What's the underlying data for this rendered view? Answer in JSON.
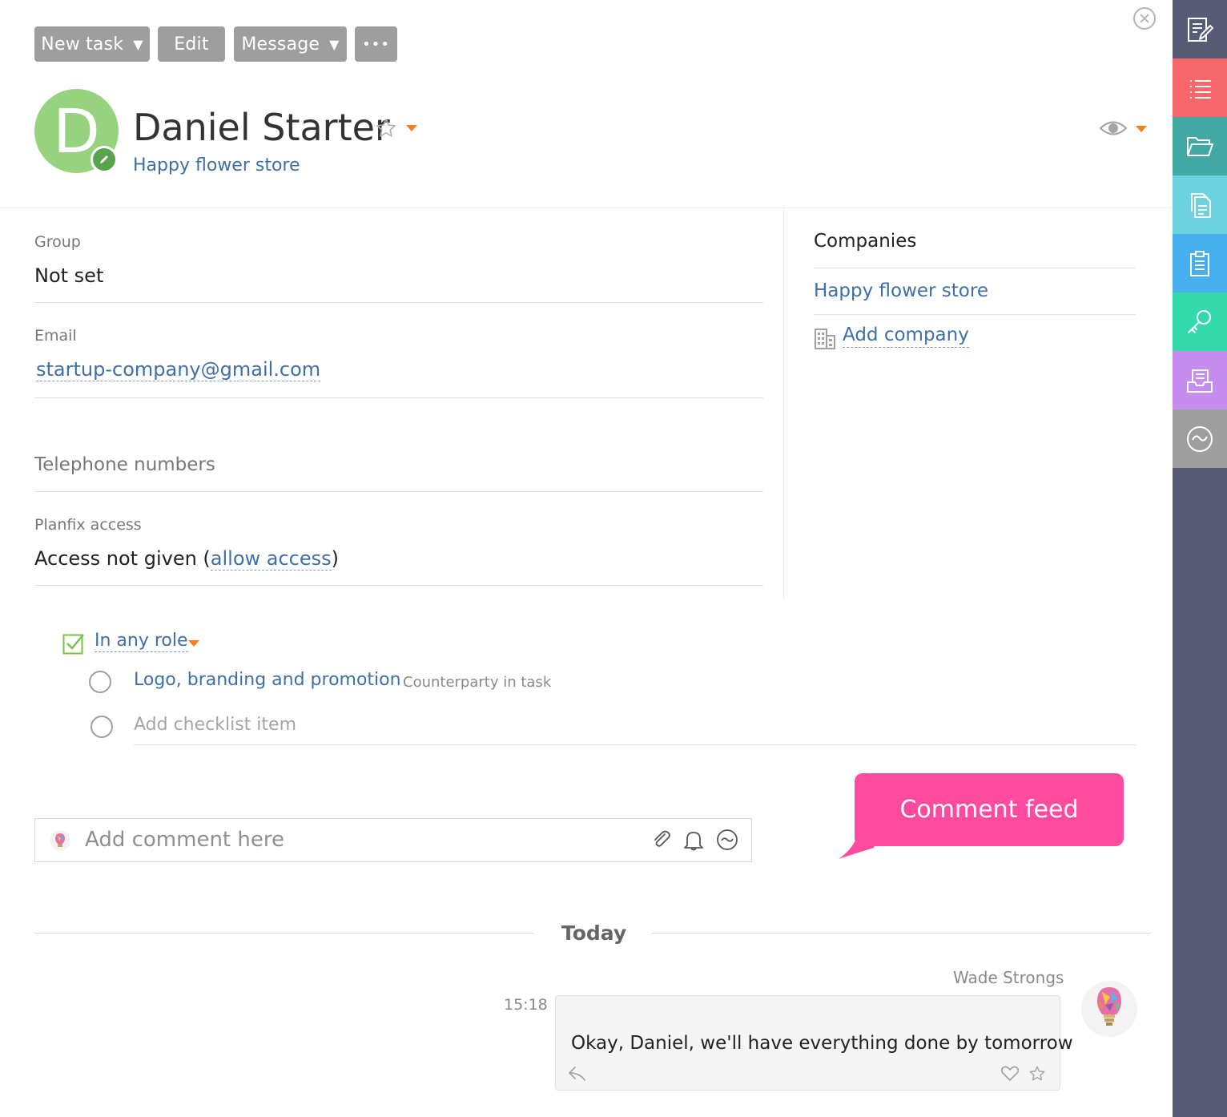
{
  "toolbar": {
    "new_task": "New task",
    "edit": "Edit",
    "message": "Message",
    "more": "•••",
    "caret": "▼"
  },
  "contact": {
    "initial": "D",
    "name": "Daniel Starter",
    "company": "Happy flower store"
  },
  "fields": {
    "group_label": "Group",
    "group_value": "Not set",
    "email_label": "Email",
    "email_value": "startup-company@gmail.com",
    "phone_label": "Telephone numbers",
    "access_label": "Planfix access",
    "access_value": "Access not given (",
    "access_link": "allow access",
    "access_close": ")"
  },
  "companies": {
    "title": "Companies",
    "items": [
      "Happy flower store"
    ],
    "add_label": "Add company"
  },
  "roles": {
    "filter_label": "In any role",
    "tasks": [
      {
        "title": "Logo, branding and promotion",
        "role": "Counterparty in task"
      }
    ],
    "add_placeholder": "Add checklist item"
  },
  "tooltip": {
    "text": "Comment feed"
  },
  "comment_input": {
    "placeholder": "Add comment here"
  },
  "feed": {
    "date_separator": "Today",
    "messages": [
      {
        "author": "Wade Strongs",
        "time": "15:18",
        "text": "Okay, Daniel, we'll have everything done by tomorrow"
      }
    ]
  },
  "colors": {
    "accent_orange": "#f57e16",
    "link_blue": "#3f6fa5",
    "tooltip_pink": "#fe4a9f",
    "avatar_green": "#97d37e",
    "sidebar_bg": "#585b76"
  },
  "sidebar": {
    "items": [
      {
        "icon": "edit-note-icon",
        "color": "#585b76"
      },
      {
        "icon": "list-icon",
        "color": "#f7676a"
      },
      {
        "icon": "folder-icon",
        "color": "#42a8a4"
      },
      {
        "icon": "documents-icon",
        "color": "#6bd3e0"
      },
      {
        "icon": "clipboard-icon",
        "color": "#46b0ee"
      },
      {
        "icon": "key-icon",
        "color": "#33d9a9"
      },
      {
        "icon": "inbox-icon",
        "color": "#c58df0"
      },
      {
        "icon": "activity-icon",
        "color": "#9e9e9e"
      }
    ]
  }
}
